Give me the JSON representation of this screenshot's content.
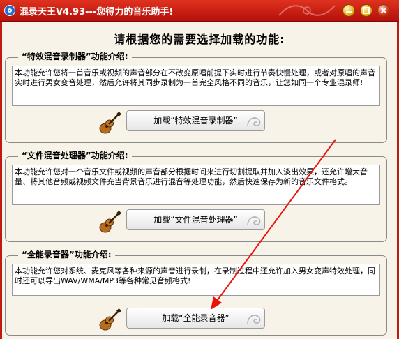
{
  "window": {
    "title": "混录天王V4.93---您得力的音乐助手!"
  },
  "heading": "请根据您的需要选择加载的功能:",
  "sections": [
    {
      "title": "“特效混音录制器”功能介绍:",
      "description": "本功能允许您将一首音乐或视频的声音部分在不改变原唱前提下实时进行节奏快慢处理，或者对原唱的声音实时进行男女变音处理，然后允许将其同步录制为一首完全风格不同的音乐，让您如同一个专业混录师!",
      "button_label": "加载“特效混音录制器”"
    },
    {
      "title": "“文件混音处理器”功能介绍:",
      "description": "本功能允许您对一个音乐文件或视频的声音部分根据时间来进行切割提取并加入淡出效果，还允许增大音量、将其他音频或视频文件充当背景音乐进行混音等处理功能，然后快速保存为新的音乐文件格式。",
      "button_label": "加载“文件混音处理器”"
    },
    {
      "title": "“全能录音器”功能介绍:",
      "description": "本功能允许您对系统、麦克风等各种来源的声音进行录制，在录制过程中还允许加入男女变声特效处理，同时还可以导出WAV/WMA/MP3等各种常见音频格式!",
      "button_label": "加载“全能录音器”"
    }
  ],
  "icons": {
    "app": "app-disc-icon",
    "guitar": "guitar-icon",
    "minimize": "minimize-icon",
    "maximize": "maximize-icon",
    "close": "close-icon"
  },
  "colors": {
    "titlebar": "#c8180e",
    "window_bg": "#f7f3e8",
    "arrow": "#e8140c"
  }
}
